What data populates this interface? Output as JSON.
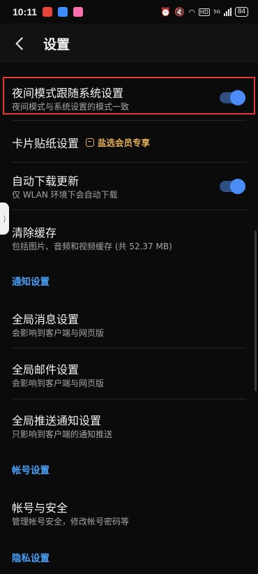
{
  "status_bar": {
    "time": "10:11",
    "battery": "84",
    "network": "HD",
    "signal_label": "5G"
  },
  "header": {
    "title": "设置"
  },
  "settings": {
    "night_mode": {
      "title": "夜间模式跟随系统设置",
      "subtitle": "夜间模式与系统设置的模式一致",
      "enabled": true
    },
    "card_sticker": {
      "title": "卡片贴纸设置",
      "badge": "盐选会员专享"
    },
    "auto_update": {
      "title": "自动下载更新",
      "subtitle": "仅 WLAN 环境下会自动下载",
      "enabled": true
    },
    "clear_cache": {
      "title": "清除缓存",
      "subtitle": "包括图片、音频和视频缓存 (共 52.37 MB)"
    },
    "notification_section": {
      "title": "通知设置"
    },
    "global_message": {
      "title": "全局消息设置",
      "subtitle": "会影响到客户端与网页版"
    },
    "global_mail": {
      "title": "全局邮件设置",
      "subtitle": "会影响到客户端与网页版"
    },
    "global_push": {
      "title": "全局推送通知设置",
      "subtitle": "只影响到客户端的通知推送"
    },
    "account_section": {
      "title": "帐号设置"
    },
    "account_security": {
      "title": "帐号与安全",
      "subtitle": "管理帐号安全，修改帐号密码等"
    },
    "privacy_section": {
      "title": "隐私设置"
    }
  },
  "colors": {
    "accent": "#4a9ff5",
    "toggle_on": "#4a8df6",
    "highlight": "#e53935",
    "vip": "#e4b15a"
  }
}
